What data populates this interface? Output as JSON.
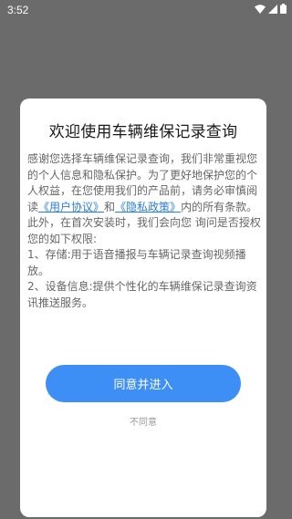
{
  "status_bar": {
    "time": "3:52",
    "icons": [
      "wifi-icon",
      "signal-icon",
      "battery-icon"
    ]
  },
  "dialog": {
    "title": "欢迎使用车辆维保记录查询",
    "body": {
      "intro": "感谢您选择车辆维保记录查询，我们非常重视您的个人信息和隐私保护。为了更好地保护您的个人权益，在您使用我们的产品前，请务必审慎阅读",
      "user_agreement_link": "《用户协议》",
      "and": "和",
      "privacy_policy_link": "《隐私政策》",
      "after_links": "内的所有条款。此外，在首次安装时，我们会向您 询问是否授权您的如下权限:",
      "item1": "1、存储:用于语音播报与车辆记录查询视频播放。",
      "item2": "2、设备信息:提供个性化的车辆维保记录查询资讯推送服务。"
    },
    "agree_button": "同意并进入",
    "disagree_button": "不同意"
  },
  "colors": {
    "overlay": "#6b6b6b",
    "link": "#2a7de1",
    "button": "#3d8ef5"
  }
}
